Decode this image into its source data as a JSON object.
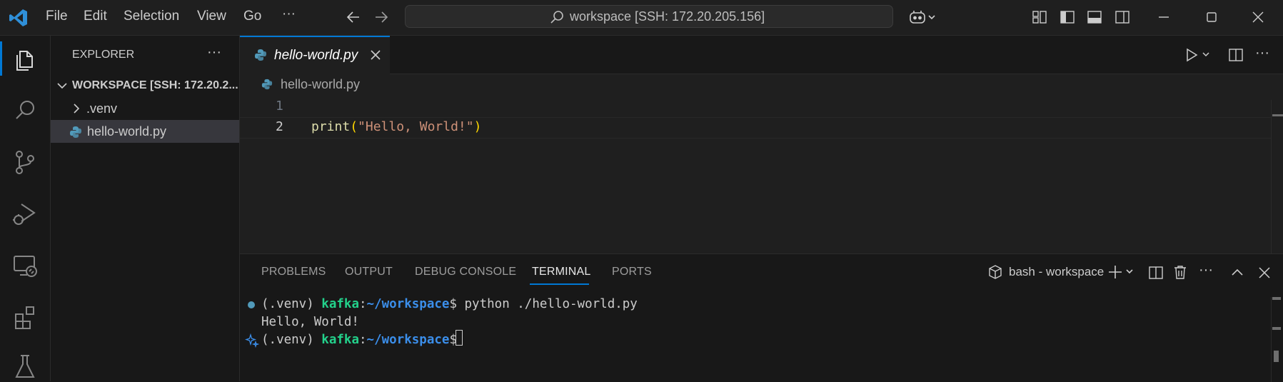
{
  "titlebar": {
    "menu": [
      "File",
      "Edit",
      "Selection",
      "View",
      "Go",
      "···"
    ],
    "command_center_text": "workspace [SSH: 172.20.205.156]"
  },
  "sidebar": {
    "title": "EXPLORER",
    "more": "···",
    "workspace_label": "WORKSPACE [SSH: 172.20.2...",
    "items": [
      {
        "label": ".venv",
        "type": "folder"
      },
      {
        "label": "hello-world.py",
        "type": "file",
        "selected": true
      }
    ]
  },
  "editor": {
    "tab_label": "hello-world.py",
    "breadcrumb": "hello-world.py",
    "lines": [
      {
        "number": "1",
        "fn": "",
        "open": "",
        "str": "",
        "close": ""
      },
      {
        "number": "2",
        "fn": "print",
        "open": "(",
        "str": "\"Hello, World!\"",
        "close": ")"
      }
    ],
    "actions_more": "···"
  },
  "panel": {
    "tabs": [
      "PROBLEMS",
      "OUTPUT",
      "DEBUG CONSOLE",
      "TERMINAL",
      "PORTS"
    ],
    "active_tab": "TERMINAL",
    "terminal_name": "bash - workspace",
    "more": "···",
    "terminal": {
      "line1": {
        "venv": "(.venv) ",
        "user": "kafka",
        "colon": ":",
        "path": "~/workspace",
        "prompt": "$ ",
        "command": "python ./hello-world.py"
      },
      "output": "Hello, World!",
      "line3": {
        "venv": "(.venv) ",
        "user": "kafka",
        "colon": ":",
        "path": "~/workspace",
        "prompt": "$ "
      }
    }
  },
  "colors": {
    "accent": "#0078d4",
    "python_icon": "#519aba",
    "terminal_user": "#23d18b",
    "terminal_path": "#3b8eea",
    "string": "#ce9178",
    "function": "#dcdcaa"
  }
}
